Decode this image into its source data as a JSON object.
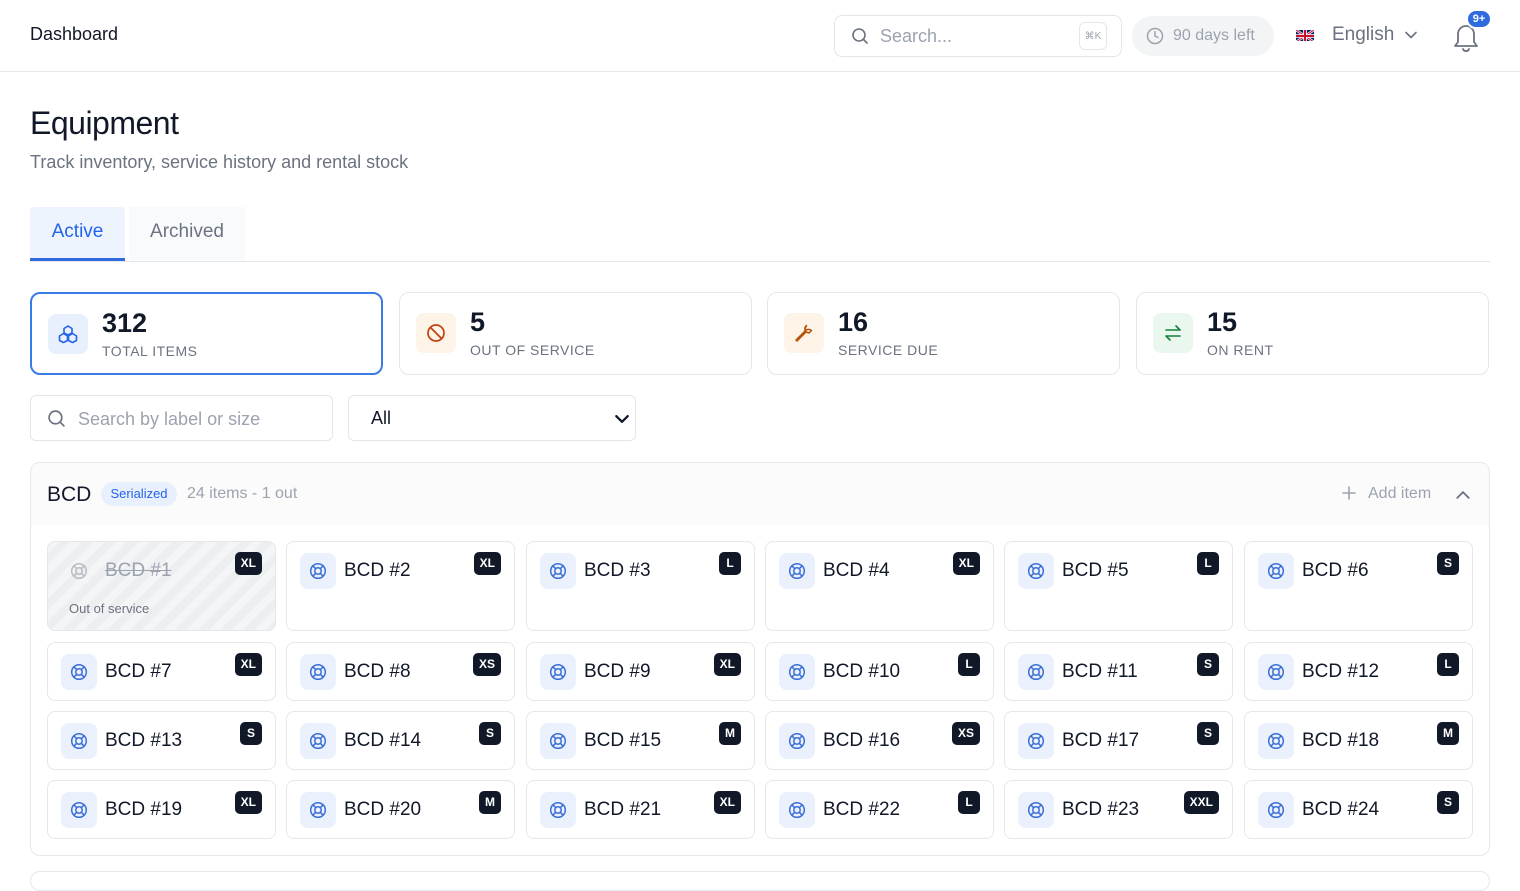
{
  "header": {
    "title": "Dashboard",
    "search_placeholder": "Search...",
    "search_shortcut": "⌘K",
    "trial_text": "90 days left",
    "language": "English",
    "notification_badge": "9+"
  },
  "page": {
    "title": "Equipment",
    "subtitle": "Track inventory, service history and rental stock"
  },
  "tabs": [
    {
      "label": "Active",
      "active": true
    },
    {
      "label": "Archived",
      "active": false
    }
  ],
  "stats": [
    {
      "value": "312",
      "label": "TOTAL ITEMS",
      "icon": "boxes-icon",
      "color": "#2563eb",
      "bg": "#e8f0fd",
      "selected": true
    },
    {
      "value": "5",
      "label": "OUT OF SERVICE",
      "icon": "ban-icon",
      "color": "#c2410c",
      "bg": "#fdf3e7",
      "selected": false
    },
    {
      "value": "16",
      "label": "SERVICE DUE",
      "icon": "wrench-icon",
      "color": "#b45309",
      "bg": "#fdf3e7",
      "selected": false
    },
    {
      "value": "15",
      "label": "ON RENT",
      "icon": "swap-arrows-icon",
      "color": "#15803d",
      "bg": "#e9f7ee",
      "selected": false
    }
  ],
  "filters": {
    "search_placeholder": "Search by label or size",
    "select_value": "All"
  },
  "group": {
    "name": "BCD",
    "tag": "Serialized",
    "meta": "24 items - 1 out",
    "add_label": "Add item",
    "item_icon": "lifebuoy-icon",
    "items": [
      {
        "label": "BCD #1",
        "size": "XL",
        "out": true,
        "note": "Out of service"
      },
      {
        "label": "BCD #2",
        "size": "XL"
      },
      {
        "label": "BCD #3",
        "size": "L"
      },
      {
        "label": "BCD #4",
        "size": "XL"
      },
      {
        "label": "BCD #5",
        "size": "L"
      },
      {
        "label": "BCD #6",
        "size": "S"
      },
      {
        "label": "BCD #7",
        "size": "XL"
      },
      {
        "label": "BCD #8",
        "size": "XS"
      },
      {
        "label": "BCD #9",
        "size": "XL"
      },
      {
        "label": "BCD #10",
        "size": "L"
      },
      {
        "label": "BCD #11",
        "size": "S"
      },
      {
        "label": "BCD #12",
        "size": "L"
      },
      {
        "label": "BCD #13",
        "size": "S"
      },
      {
        "label": "BCD #14",
        "size": "S"
      },
      {
        "label": "BCD #15",
        "size": "M"
      },
      {
        "label": "BCD #16",
        "size": "XS"
      },
      {
        "label": "BCD #17",
        "size": "S"
      },
      {
        "label": "BCD #18",
        "size": "M"
      },
      {
        "label": "BCD #19",
        "size": "XL"
      },
      {
        "label": "BCD #20",
        "size": "M"
      },
      {
        "label": "BCD #21",
        "size": "XL"
      },
      {
        "label": "BCD #22",
        "size": "L"
      },
      {
        "label": "BCD #23",
        "size": "XXL"
      },
      {
        "label": "BCD #24",
        "size": "S"
      }
    ]
  }
}
